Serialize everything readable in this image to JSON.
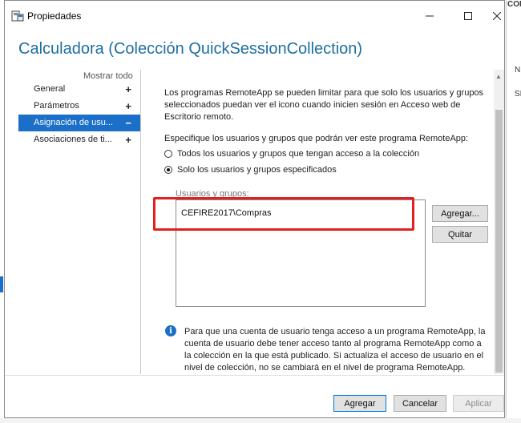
{
  "window": {
    "title": "Propiedades",
    "heading": "Calculadora (Colección QuickSessionCollection)"
  },
  "nav": {
    "show_all": "Mostrar todo",
    "items": [
      {
        "label": "General",
        "expander": "+"
      },
      {
        "label": "Parámetros",
        "expander": "+"
      },
      {
        "label": "Asignación de usu...",
        "expander": "−"
      },
      {
        "label": "Asociaciones de ti...",
        "expander": "+"
      }
    ]
  },
  "content": {
    "intro": "Los programas RemoteApp se pueden limitar para que solo los usuarios y grupos seleccionados puedan ver el icono cuando inicien sesión en Acceso web de Escritorio remoto.",
    "specify": "Especifique los usuarios y grupos que podrán ver este programa RemoteApp:",
    "options": [
      {
        "label": "Todos los usuarios y grupos que tengan acceso a la colección",
        "checked": false
      },
      {
        "label": "Solo los usuarios y grupos especificados",
        "checked": true
      }
    ],
    "users_label": "Usuarios y grupos:",
    "users": [
      "CEFIRE2017\\Compras"
    ],
    "add_user_button": "Agregar...",
    "remove_button": "Quitar",
    "info": "Para que una cuenta de usuario tenga acceso a un programa RemoteApp, la cuenta de usuario debe tener acceso tanto al programa RemoteApp como a la colección en la que está publicado. Si actualiza el acceso de usuario en el nivel de colección, no se cambiará en el nivel de programa RemoteApp."
  },
  "footer": {
    "ok": "Agregar",
    "cancel": "Cancelar",
    "apply": "Aplicar"
  },
  "background": {
    "right_header": "CONE",
    "right_n": "N",
    "right_s": "SI"
  },
  "colors": {
    "accent": "#1c6fc8",
    "heading": "#1d6ea1",
    "highlight": "#e32020"
  }
}
